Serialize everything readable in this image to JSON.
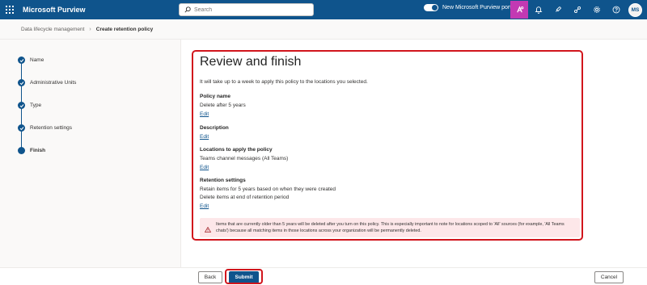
{
  "app": {
    "title": "Microsoft Purview",
    "search_placeholder": "Search",
    "portal_toggle_label": "New Microsoft Purview portal",
    "user_initials": "MS"
  },
  "breadcrumb": {
    "parent": "Data lifecycle management",
    "current": "Create retention policy"
  },
  "steps": [
    {
      "label": "Name",
      "state": "complete"
    },
    {
      "label": "Administrative Units",
      "state": "complete"
    },
    {
      "label": "Type",
      "state": "complete"
    },
    {
      "label": "Retention settings",
      "state": "complete"
    },
    {
      "label": "Finish",
      "state": "current"
    }
  ],
  "review": {
    "heading": "Review and finish",
    "intro": "It will take up to a week to apply this policy to the locations you selected.",
    "edit_label": "Edit",
    "policy_name": {
      "title": "Policy name",
      "value": "Delete after 5 years"
    },
    "description": {
      "title": "Description"
    },
    "locations": {
      "title": "Locations to apply the policy",
      "value": "Teams channel messages (All Teams)"
    },
    "retention": {
      "title": "Retention settings",
      "line1": "Retain items for 5 years based on when they were created",
      "line2": "Delete items at end of retention period"
    },
    "warning": "Items that are currently older than 5 years will be deleted after you turn on this policy. This is especially important to note for locations scoped to 'All' sources (for example, 'All Teams chats') because all matching items in those locations across your organization will be permanently deleted."
  },
  "footer": {
    "back": "Back",
    "submit": "Submit",
    "cancel": "Cancel"
  },
  "colors": {
    "brand": "#0f548c",
    "highlight": "#d1151c",
    "warning_bg": "#fde7e9",
    "active_icon": "#c239b3"
  }
}
